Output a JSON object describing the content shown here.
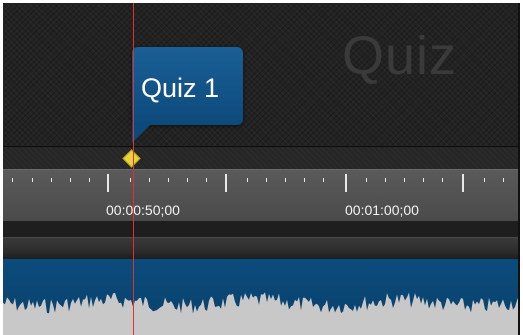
{
  "quiz_track": {
    "watermark_text": "Quiz"
  },
  "marker": {
    "label": "Quiz 1"
  },
  "ruler": {
    "time_labels": [
      "00:00:50;00",
      "00:01:00;00"
    ]
  },
  "colors": {
    "marker_callout": "#0d4a7c",
    "marker_diamond": "#e6d43a",
    "playhead": "#e03030",
    "audio_clip": "#0b4c7c",
    "waveform": "#c8c8c8"
  }
}
